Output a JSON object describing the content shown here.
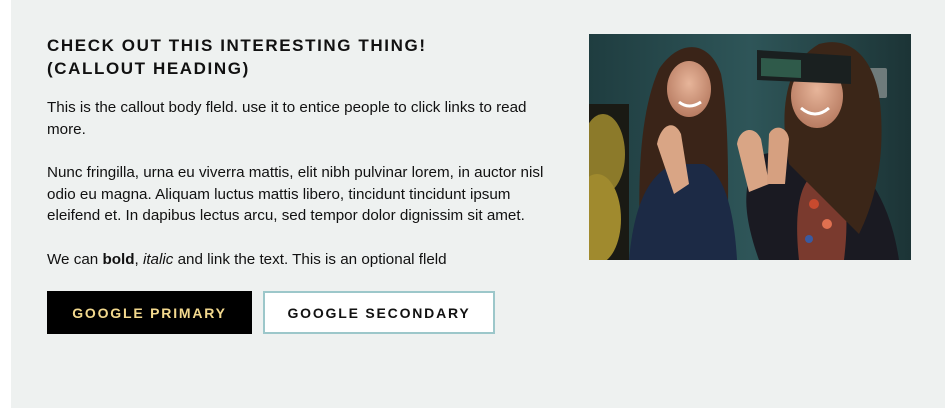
{
  "callout": {
    "heading_line1": "CHECK OUT THIS INTERESTING THING!",
    "heading_line2": "(CALLOUT HEADING)",
    "body_intro": "This is the callout body fleld. use it to entice people to click links to read more.",
    "body_paragraph": "Nunc fringilla, urna eu viverra mattis, elit nibh pulvinar lorem, in auctor nisl odio eu magna. Aliquam luctus mattis libero, tincidunt tincidunt ipsum eleifend et. In dapibus lectus arcu, sed tempor dolor dignissim sit amet.",
    "rich_prefix": "We can ",
    "rich_bold": "bold",
    "rich_sep": ", ",
    "rich_italic": "italic",
    "rich_suffix": " and link the text. This is an optional fleld",
    "primary_button": "GOOGLE PRIMARY",
    "secondary_button": "GOOGLE SECONDARY"
  },
  "colors": {
    "background": "#eef1f0",
    "primary_button_bg": "#000000",
    "primary_button_text": "#f3d98e",
    "secondary_button_border": "#9cc7ca"
  }
}
